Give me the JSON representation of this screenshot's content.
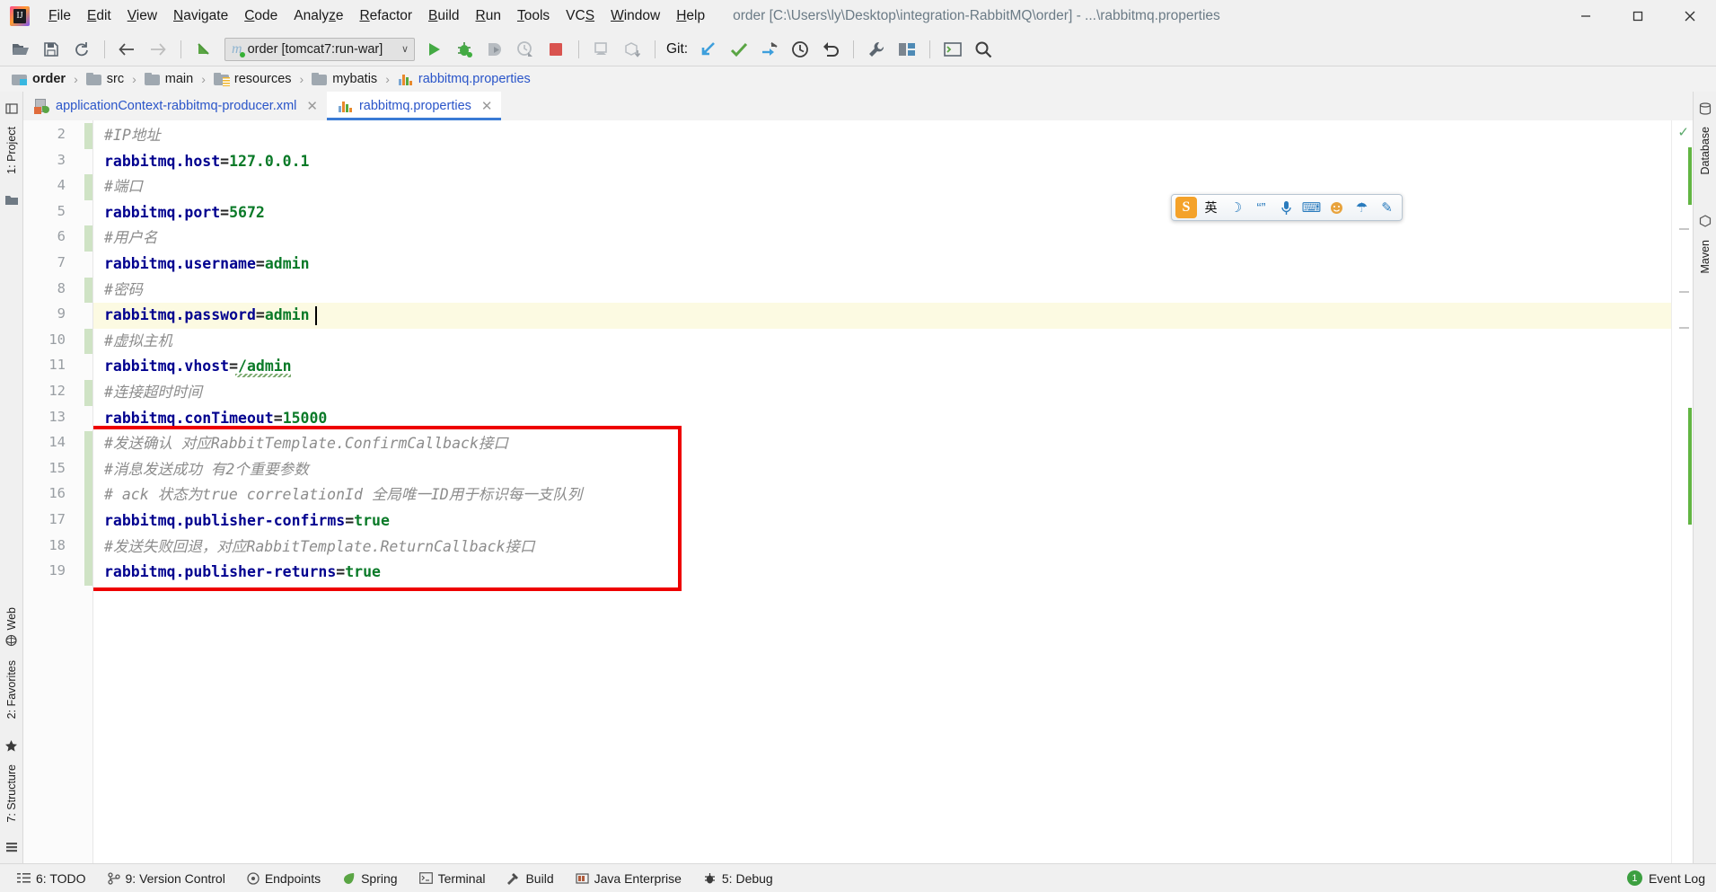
{
  "window": {
    "title": "order [C:\\Users\\ly\\Desktop\\integration-RabbitMQ\\order] - ...\\rabbitmq.properties",
    "app_icon": "intellij-idea-logo",
    "minimize": "—",
    "maximize": "❐",
    "close": "✕"
  },
  "menubar": {
    "items": [
      {
        "label": "File"
      },
      {
        "label": "Edit"
      },
      {
        "label": "View"
      },
      {
        "label": "Navigate"
      },
      {
        "label": "Code"
      },
      {
        "label": "Analyze"
      },
      {
        "label": "Refactor"
      },
      {
        "label": "Build"
      },
      {
        "label": "Run"
      },
      {
        "label": "Tools"
      },
      {
        "label": "VCS"
      },
      {
        "label": "Window"
      },
      {
        "label": "Help"
      }
    ]
  },
  "toolbar": {
    "open_icon": "open-folder-icon",
    "save_icon": "save-icon",
    "sync_icon": "sync-icon",
    "back_icon": "arrow-back-icon",
    "forward_icon": "arrow-forward-icon",
    "jump_icon": "jump-to-source-icon",
    "run_config": {
      "label": "order [tomcat7:run-war]",
      "module_glyph": "m",
      "caret": "∨"
    },
    "run_icon": "run-icon",
    "debug_icon": "debug-icon",
    "run_coverage_icon": "run-with-coverage-icon",
    "profile_icon": "profile-icon",
    "stop_icon": "stop-icon",
    "deploy_icon": "deploy-icon",
    "package_icon": "package-download-icon",
    "git_label": "Git:",
    "git_update_icon": "update-project-icon",
    "git_commit_icon": "commit-checkmark-icon",
    "git_push_icon": "push-icon",
    "git_history_icon": "history-clock-icon",
    "git_rollback_icon": "rollback-icon",
    "settings_icon": "wrench-settings-icon",
    "project_structure_icon": "project-structure-icon",
    "terminal_icon": "terminal-icon",
    "search_icon": "search-everywhere-icon"
  },
  "breadcrumbs": [
    {
      "label": "order",
      "icon": "module-folder-icon",
      "bold": true
    },
    {
      "label": "src",
      "icon": "folder-icon",
      "bold": false
    },
    {
      "label": "main",
      "icon": "folder-icon",
      "bold": false
    },
    {
      "label": "resources",
      "icon": "resources-folder-icon",
      "bold": false
    },
    {
      "label": "mybatis",
      "icon": "folder-icon",
      "bold": false
    },
    {
      "label": "rabbitmq.properties",
      "icon": "properties-file-icon",
      "bold": false,
      "link": true
    }
  ],
  "breadcrumb_separator": "›",
  "tabs": [
    {
      "label": "applicationContext-rabbitmq-producer.xml",
      "icon": "spring-xml-file-icon",
      "active": false,
      "close": "✕"
    },
    {
      "label": "rabbitmq.properties",
      "icon": "properties-file-icon",
      "active": true,
      "close": "✕"
    }
  ],
  "left_rail": {
    "top": [
      {
        "label": "1: Project",
        "icon": "project-tool-icon"
      }
    ],
    "bottom": [
      {
        "label": "Web",
        "icon": "web-tool-icon"
      },
      {
        "label": "2: Favorites",
        "icon": "favorites-star-icon"
      },
      {
        "label": "7: Structure",
        "icon": "structure-tool-icon"
      }
    ]
  },
  "right_rail": {
    "items": [
      {
        "label": "Database",
        "icon": "database-tool-icon"
      },
      {
        "label": "Maven",
        "icon": "maven-tool-icon"
      }
    ]
  },
  "editor": {
    "first_line_number": 2,
    "highlighted_line": 9,
    "caret_line": 9,
    "lines": [
      {
        "n": 2,
        "segments": [
          {
            "t": "#IP地址",
            "c": "cmt"
          }
        ]
      },
      {
        "n": 3,
        "segments": [
          {
            "t": "rabbitmq.host",
            "c": "key"
          },
          {
            "t": "=",
            "c": "eq"
          },
          {
            "t": "127.0.0.1",
            "c": "val"
          }
        ]
      },
      {
        "n": 4,
        "segments": [
          {
            "t": "#端口",
            "c": "cmt"
          }
        ]
      },
      {
        "n": 5,
        "segments": [
          {
            "t": "rabbitmq.port",
            "c": "key"
          },
          {
            "t": "=",
            "c": "eq"
          },
          {
            "t": "5672",
            "c": "val"
          }
        ]
      },
      {
        "n": 6,
        "segments": [
          {
            "t": "#用户名",
            "c": "cmt"
          }
        ]
      },
      {
        "n": 7,
        "segments": [
          {
            "t": "rabbitmq.username",
            "c": "key"
          },
          {
            "t": "=",
            "c": "eq"
          },
          {
            "t": "admin",
            "c": "val"
          }
        ]
      },
      {
        "n": 8,
        "segments": [
          {
            "t": "#密码",
            "c": "cmt"
          }
        ]
      },
      {
        "n": 9,
        "segments": [
          {
            "t": "rabbitmq.password",
            "c": "key"
          },
          {
            "t": "=",
            "c": "eq"
          },
          {
            "t": "admin",
            "c": "val"
          }
        ]
      },
      {
        "n": 10,
        "segments": [
          {
            "t": "#虚拟主机",
            "c": "cmt"
          }
        ]
      },
      {
        "n": 11,
        "segments": [
          {
            "t": "rabbitmq.vhost",
            "c": "key"
          },
          {
            "t": "=",
            "c": "eq"
          },
          {
            "t": "/admin",
            "c": "val"
          }
        ]
      },
      {
        "n": 12,
        "segments": [
          {
            "t": "#连接超时时间",
            "c": "cmt"
          }
        ]
      },
      {
        "n": 13,
        "segments": [
          {
            "t": "rabbitmq.conTimeout",
            "c": "key"
          },
          {
            "t": "=",
            "c": "eq"
          },
          {
            "t": "15000",
            "c": "val"
          }
        ]
      },
      {
        "n": 14,
        "segments": [
          {
            "t": "#发送确认 对应RabbitTemplate.ConfirmCallback接口",
            "c": "cmt"
          }
        ]
      },
      {
        "n": 15,
        "segments": [
          {
            "t": "#消息发送成功 有2个重要参数",
            "c": "cmt"
          }
        ]
      },
      {
        "n": 16,
        "segments": [
          {
            "t": "# ack 状态为true correlationId 全局唯一ID用于标识每一支队列",
            "c": "cmt"
          }
        ]
      },
      {
        "n": 17,
        "segments": [
          {
            "t": "rabbitmq.publisher-confirms",
            "c": "key"
          },
          {
            "t": "=",
            "c": "eq"
          },
          {
            "t": "true",
            "c": "val"
          }
        ]
      },
      {
        "n": 18,
        "segments": [
          {
            "t": "#发送失败回退，对应RabbitTemplate.ReturnCallback接口",
            "c": "cmt"
          }
        ]
      },
      {
        "n": 19,
        "segments": [
          {
            "t": "rabbitmq.publisher-returns",
            "c": "key"
          },
          {
            "t": "=",
            "c": "eq"
          },
          {
            "t": "true",
            "c": "val"
          }
        ]
      }
    ],
    "annotation": {
      "type": "red-rectangle",
      "color": "#ee0000",
      "covers_lines": "14-19"
    },
    "inspection_status": "✓"
  },
  "ime": {
    "logo": "S",
    "items": [
      {
        "glyph": "英",
        "name": "language-mode-english"
      },
      {
        "glyph": "☽",
        "name": "moon-icon"
      },
      {
        "glyph": "“”",
        "name": "quotes-icon"
      },
      {
        "glyph": "⌨",
        "name": "keyboard-icon"
      },
      {
        "glyph": "☻",
        "name": "emoji-icon"
      },
      {
        "glyph": "☂",
        "name": "umbrella-icon"
      },
      {
        "glyph": "✎",
        "name": "tools-icon"
      }
    ]
  },
  "statusbar": {
    "items": [
      {
        "label": "6: TODO",
        "icon": "todo-icon"
      },
      {
        "label": "9: Version Control",
        "icon": "version-control-icon"
      },
      {
        "label": "Endpoints",
        "icon": "endpoints-icon"
      },
      {
        "label": "Spring",
        "icon": "spring-leaf-icon"
      },
      {
        "label": "Terminal",
        "icon": "terminal-icon"
      },
      {
        "label": "Build",
        "icon": "build-hammer-icon"
      },
      {
        "label": "Java Enterprise",
        "icon": "java-enterprise-icon"
      },
      {
        "label": "5: Debug",
        "icon": "debug-bug-icon"
      }
    ],
    "event_log": {
      "label": "Event Log",
      "badge": "1",
      "icon": "event-log-icon"
    }
  }
}
